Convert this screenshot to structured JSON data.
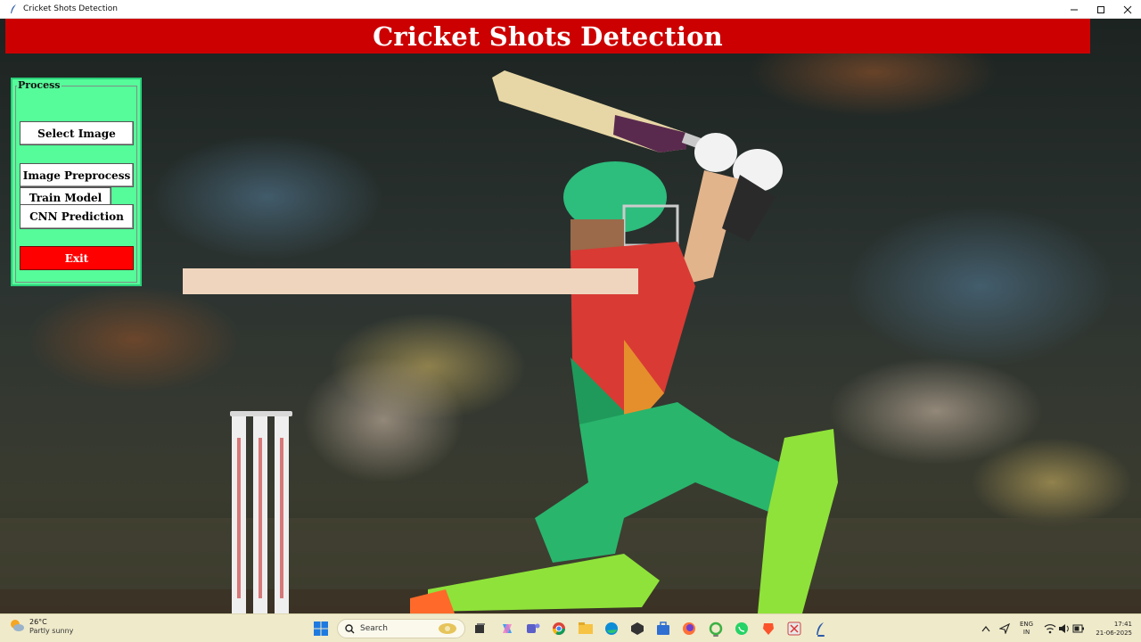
{
  "window": {
    "title": "Cricket Shots Detection",
    "icon": "feather-icon",
    "controls": [
      "minimize-icon",
      "maximize-icon",
      "close-icon"
    ]
  },
  "header": {
    "title": "Cricket Shots Detection",
    "background_color": "#cc0000",
    "text_color": "#ffffff"
  },
  "process_panel": {
    "legend": "Process",
    "background_color": "#56fb9a",
    "buttons": {
      "select_image": "Select Image",
      "image_preprocess": "Image Preprocess",
      "train_model": "Train Model",
      "cnn_prediction": "CNN Prediction",
      "exit": "Exit"
    },
    "exit_color": "#ff0000"
  },
  "result_bar": {
    "color": "#efd5bd",
    "text": ""
  },
  "taskbar": {
    "weather": {
      "temp": "26°C",
      "desc": "Partly sunny",
      "icon": "partly-sunny-icon"
    },
    "search_placeholder": "Search",
    "apps": [
      "windows-start-icon",
      "search-icon",
      "task-view-icon",
      "copilot-icon",
      "teams-icon",
      "chrome-icon",
      "file-explorer-icon",
      "edge-icon",
      "terminal-icon",
      "store-icon",
      "firefox-icon",
      "circle-app-icon",
      "whatsapp-icon",
      "brave-icon",
      "snip-icon",
      "feather-icon"
    ],
    "language": {
      "line1": "ENG",
      "line2": "IN"
    },
    "clock": {
      "time": "17:41",
      "date": "21-06-2025"
    }
  }
}
